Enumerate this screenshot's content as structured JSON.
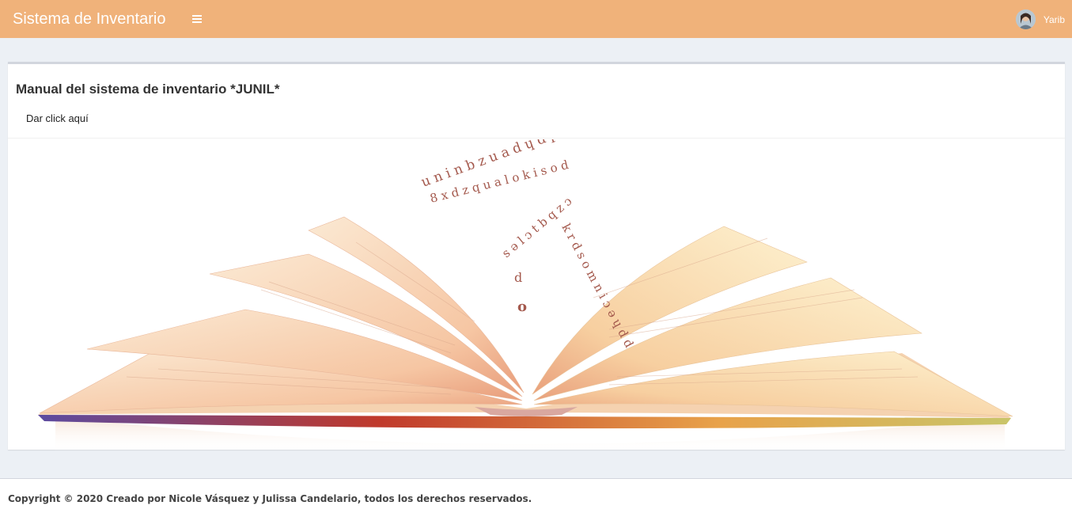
{
  "header": {
    "brand": "Sistema de Inventario",
    "menu_icon": "hamburger-icon",
    "user_name": "Yarib",
    "avatar_icon": "user-avatar",
    "bar_color": "#f0b27a"
  },
  "main": {
    "box_title": "Manual del sistema de inventario *JUNIL*",
    "link_label": "Dar click aquí",
    "illustration": "open-book-question-mark-image",
    "letters_line_a": "u n i n b z u a d ɥ d p ǝ ɔ a",
    "letters_line_b": "8 x d z q u a l o k i s o d",
    "letters_line_c": "k r d s o m n i ɔ ǝ ɥ d d",
    "letters_line_d": "s ǝ l ɔ t b q z ɔ",
    "letters_line_e": "d",
    "letters_dot": "o"
  },
  "footer": {
    "copyright": "Copyright © 2020 Creado por Nicole Vásquez y Julissa Candelario, todos los derechos reservados."
  }
}
